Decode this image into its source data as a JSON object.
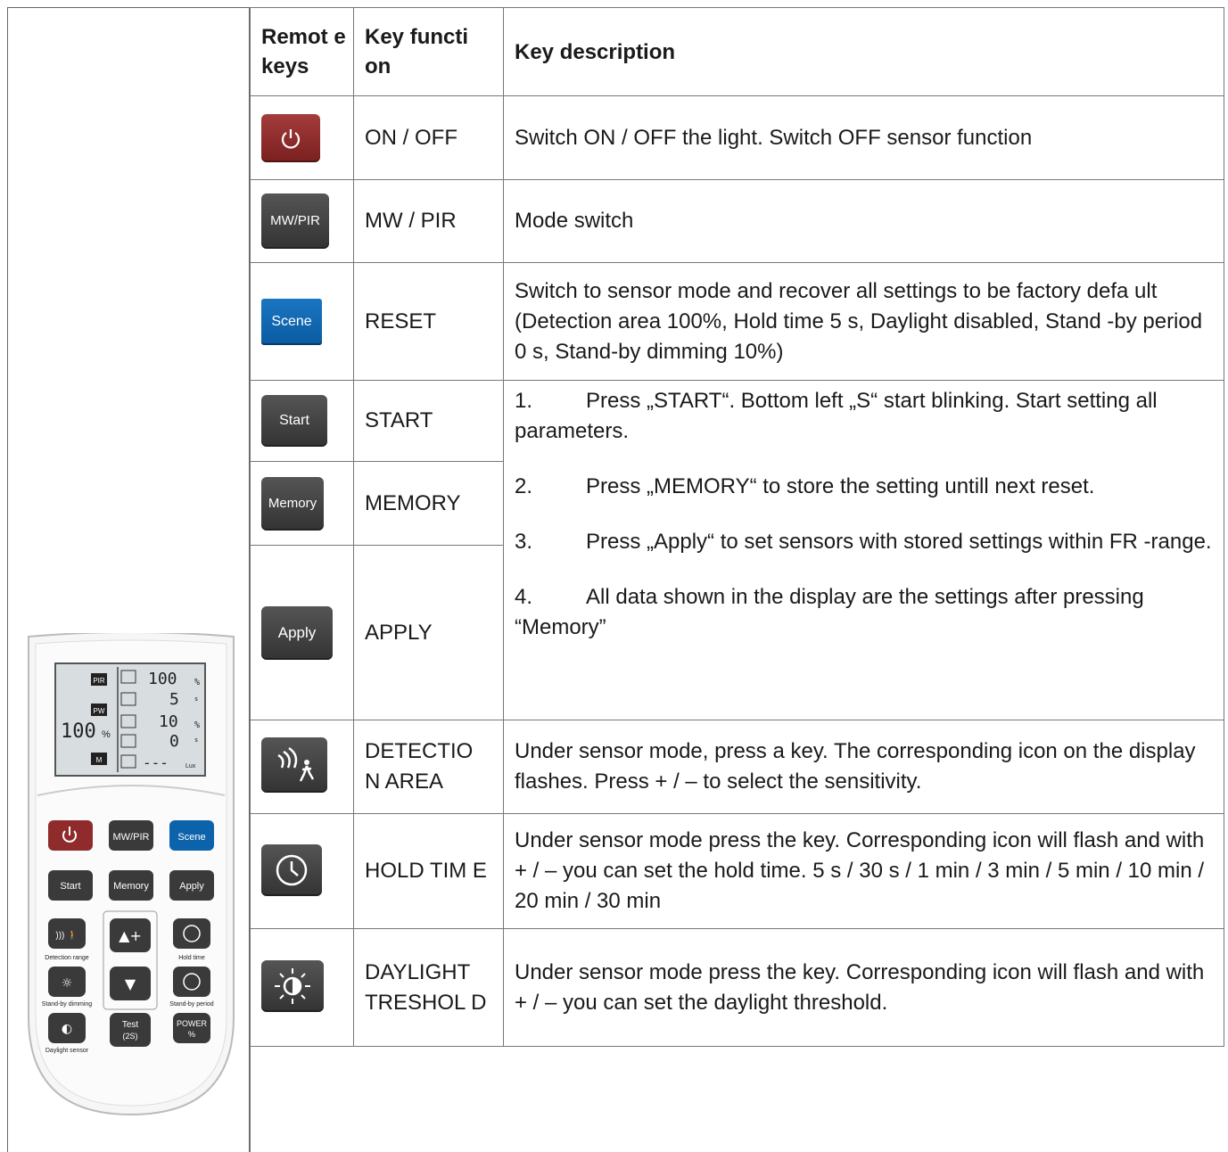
{
  "header": {
    "col1": "Remot e keys",
    "col2": "Key functi on",
    "col3": "Key description"
  },
  "rows": [
    {
      "key_label": "",
      "function": "ON / OFF",
      "description": "Switch ON / OFF the light. Switch OFF sensor function"
    },
    {
      "key_label": "MW/PIR",
      "function": "MW / PIR",
      "description": "Mode switch"
    },
    {
      "key_label": "Scene",
      "function": "RESET",
      "description": "Switch to sensor mode and recover all settings to be factory defa ult (Detection area 100%, Hold time 5 s, Daylight disabled, Stand -by period 0 s, Stand-by dimming 10%)"
    },
    {
      "key_label": "Start",
      "function": "START"
    },
    {
      "key_label": "Memory",
      "function": "MEMORY"
    },
    {
      "key_label": "Apply",
      "function": "APPLY"
    },
    {
      "key_label": "",
      "function": "DETECTIO N AREA",
      "description": "Under sensor mode, press a key. The corresponding icon on the display flashes. Press + / – to select the sensitivity."
    },
    {
      "key_label": "",
      "function": "HOLD TIM E",
      "description": "Under sensor mode press the key. Corresponding icon will flash and with + / – you can set the hold time. 5 s / 30 s / 1 min / 3 min / 5 min / 10 min / 20 min / 30 min"
    },
    {
      "key_label": "",
      "function": "DAYLIGHT TRESHOL D",
      "description": "Under sensor mode press the key. Corresponding icon will flash and with + / – you can set the daylight threshold."
    }
  ],
  "steps": [
    {
      "num": "1.",
      "text": "Press „START“. Bottom left „S“ start blinking. Start setting all parameters."
    },
    {
      "num": "2.",
      "text": "Press „MEMORY“ to store the setting untill next reset."
    },
    {
      "num": "3.",
      "text": "Press „Apply“ to set sensors with stored settings within FR -range."
    },
    {
      "num": "4.",
      "text": "All data shown in the display are the settings after pressing “Memory”"
    }
  ],
  "remote": {
    "lcd": {
      "pir": "PIR",
      "pw": "PW",
      "m": "M",
      "big": "100",
      "big_unit": "%",
      "r1": "100",
      "r1u": "%",
      "r2": "5",
      "r2u": "s",
      "r3": "10",
      "r3u": "%",
      "r4": "0",
      "r4u": "s",
      "r5": "---",
      "r5u": "Lux"
    },
    "buttons": {
      "mwpir": "MW/PIR",
      "scene": "Scene",
      "start": "Start",
      "memory": "Memory",
      "apply": "Apply",
      "test": "Test",
      "test2": "(2S)",
      "power": "POWER",
      "power2": "%"
    },
    "labels": {
      "detection": "Detection range",
      "hold": "Hold time",
      "standby_dim": "Stand-by dimming",
      "standby_per": "Stand-by period",
      "daylight": "Daylight sensor"
    }
  },
  "colors": {
    "red_key": "#8f2b2b",
    "blue_key": "#0d63ab",
    "dark_key": "#3d3d3d"
  }
}
